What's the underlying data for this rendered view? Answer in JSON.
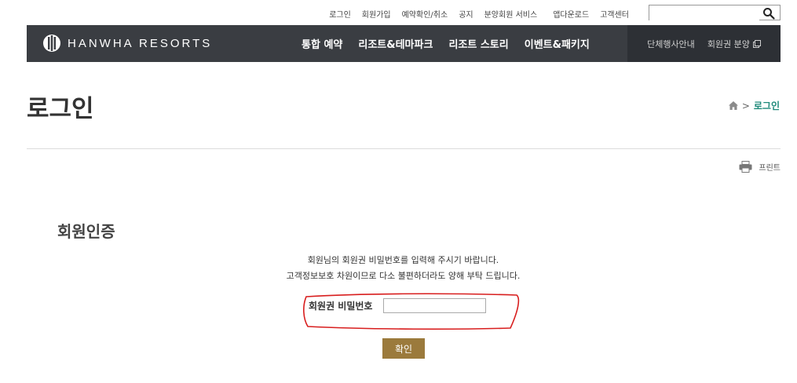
{
  "util": {
    "links": [
      "로그인",
      "회원가입",
      "예약확인/취소",
      "공지",
      "분양회원 서비스",
      "앱다운로드",
      "고객센터"
    ],
    "search_placeholder": ""
  },
  "gnb": {
    "logo_text": "HANWHA RESORTS",
    "main_menu": [
      "통합 예약",
      "리조트&테마파크",
      "리조트 스토리",
      "이벤트&패키지"
    ],
    "sub_menu": [
      "단체행사안내",
      "회원권 분양"
    ]
  },
  "page": {
    "title": "로그인",
    "breadcrumb_current": "로그인",
    "breadcrumb_sep": ">",
    "print_label": "프린트"
  },
  "auth": {
    "section_title": "회원인증",
    "desc_line1": "회원님의 회원권 비밀번호를 입력해 주시기 바랍니다.",
    "desc_line2": "고객정보보호 차원이므로 다소 불편하더라도 양해 부탁 드립니다.",
    "password_label": "회원권 비밀번호",
    "password_value": "",
    "confirm_label": "확인"
  },
  "colors": {
    "gnb_bg": "#3a3d42",
    "accent_teal": "#1f8a7a",
    "button_gold": "#9b7a3c",
    "annotation_red": "#d81e1e"
  }
}
